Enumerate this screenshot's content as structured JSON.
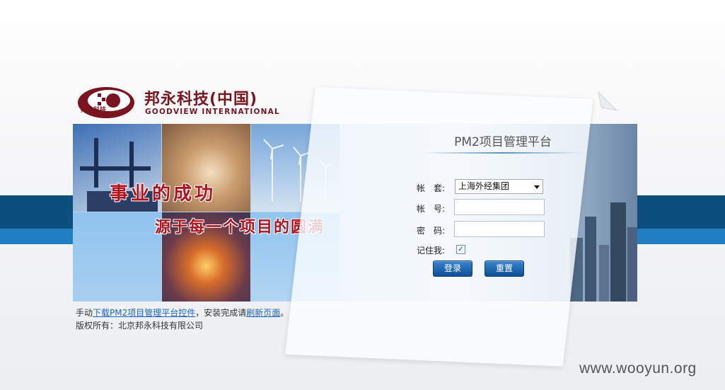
{
  "company": {
    "name_cn": "邦永科技(中国)",
    "name_en": "GOODVIEW INTERNATIONAL",
    "logo_small_text": "邦永科技"
  },
  "banner": {
    "slogan_line1": "事业的成功",
    "slogan_line2": "源于每一个项目的圆满"
  },
  "login": {
    "title": "PM2项目管理平台",
    "account_set_label": "帐　套:",
    "account_set_value": "上海外经集团",
    "username_label": "帐　号:",
    "username_value": "",
    "password_label": "密　码:",
    "password_value": "",
    "remember_label": "记住我:",
    "remember_checked": true,
    "remember_mark": "✓",
    "login_button": "登录",
    "reset_button": "重置"
  },
  "footer": {
    "line1_prefix": "手动",
    "line1_link1": "下载PM2项目管理平台控件",
    "line1_middle": "，安装完成请",
    "line1_link2": "刷新页面",
    "line1_suffix": "。",
    "copyright": "版权所有：北京邦永科技有限公司"
  },
  "watermark": "www.wooyun.org",
  "colors": {
    "brand": "#7a1420",
    "band_dark": "#0c4f7e",
    "band_light": "#1f7fc0",
    "button": "#0d4f97",
    "slogan": "#b0121e"
  }
}
